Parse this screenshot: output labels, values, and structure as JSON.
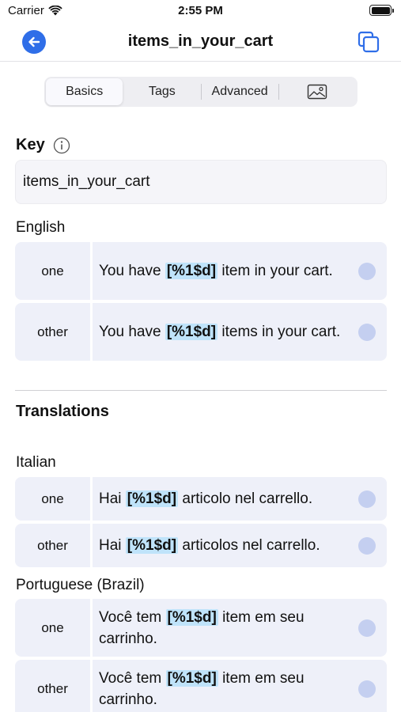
{
  "status": {
    "carrier": "Carrier",
    "time": "2:55 PM"
  },
  "nav": {
    "title": "items_in_your_cart"
  },
  "tabs": [
    {
      "label": "Basics",
      "active": true
    },
    {
      "label": "Tags"
    },
    {
      "label": "Advanced"
    },
    {
      "label": "",
      "icon": "image-icon"
    }
  ],
  "key": {
    "label": "Key",
    "value": "items_in_your_cart"
  },
  "english": {
    "label": "English",
    "rows": [
      {
        "qty": "one",
        "before": "You have ",
        "token": "[%1$d]",
        "after": " item in your cart."
      },
      {
        "qty": "other",
        "before": "You have ",
        "token": "[%1$d]",
        "after": " items in your cart."
      }
    ]
  },
  "translations": {
    "title": "Translations",
    "italian": {
      "label": "Italian",
      "rows": [
        {
          "qty": "one",
          "before": "Hai ",
          "token": "[%1$d]",
          "after": " articolo nel carrello."
        },
        {
          "qty": "other",
          "before": "Hai ",
          "token": "[%1$d]",
          "after": " articolos nel carrello."
        }
      ]
    },
    "portuguese": {
      "label": "Portuguese (Brazil)",
      "rows": [
        {
          "qty": "one",
          "before": "Você tem ",
          "token": "[%1$d]",
          "after": " item em seu carrinho."
        },
        {
          "qty": "other",
          "before": "Você tem ",
          "token": "[%1$d]",
          "after": " item em seu carrinho."
        }
      ]
    }
  },
  "colors": {
    "accent": "#2f6ee8",
    "highlight": "#bfe3fa",
    "row_bg": "#eef0f9",
    "dot": "#c4cff0"
  }
}
